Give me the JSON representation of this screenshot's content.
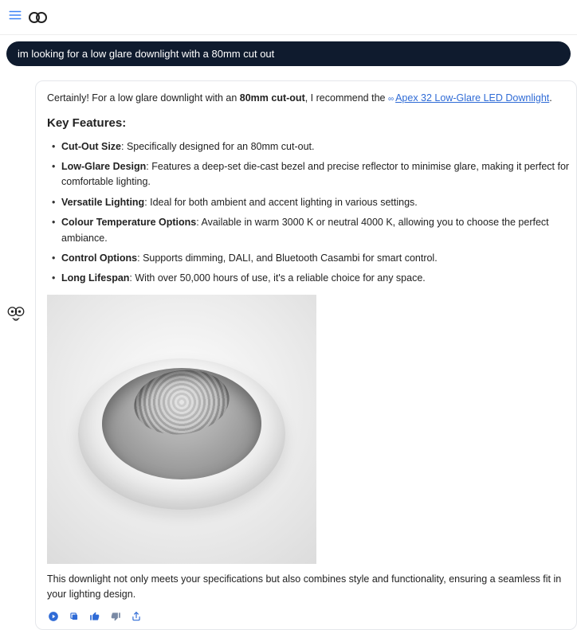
{
  "header": {
    "brand": "∞"
  },
  "user_message": "im looking for a low glare downlight with a 80mm cut out",
  "response": {
    "intro_prefix": "Certainly! For a low glare downlight with an ",
    "intro_bold": "80mm cut-out",
    "intro_suffix": ", I recommend the ",
    "product_link": "Apex 32 Low-Glare LED Downlight",
    "features_heading": "Key Features:",
    "features": [
      {
        "label": "Cut-Out Size",
        "text": ": Specifically designed for an 80mm cut-out."
      },
      {
        "label": "Low-Glare Design",
        "text": ": Features a deep-set die-cast bezel and precise reflector to minimise glare, making it perfect for comfortable lighting."
      },
      {
        "label": "Versatile Lighting",
        "text": ": Ideal for both ambient and accent lighting in various settings."
      },
      {
        "label": "Colour Temperature Options",
        "text": ": Available in warm 3000 K or neutral 4000 K, allowing you to choose the perfect ambiance."
      },
      {
        "label": "Control Options",
        "text": ": Supports dimming, DALI, and Bluetooth Casambi for smart control."
      },
      {
        "label": "Long Lifespan",
        "text": ": With over 50,000 hours of use, it's a reliable choice for any space."
      }
    ],
    "image_alt": "Apex 32 low-glare LED downlight",
    "closing": "This downlight not only meets your specifications but also combines style and functionality, ensuring a seamless fit in your lighting design."
  },
  "icons": {
    "menu": "≡",
    "link": "∞",
    "play": "►",
    "copy": "⧉",
    "thumbs_up": "👍",
    "thumbs_down": "👎",
    "share": "⇪"
  }
}
